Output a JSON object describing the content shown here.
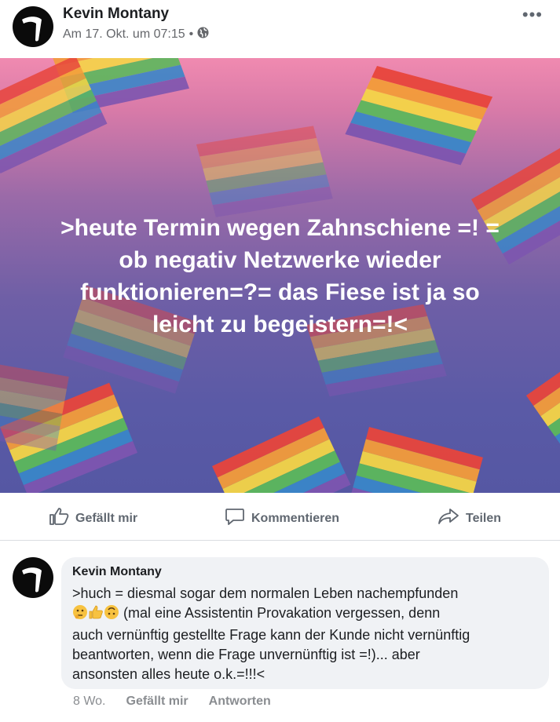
{
  "post": {
    "author": "Kevin Montany",
    "date": "Am 17. Okt. um 07:15",
    "separator": "•",
    "privacy_icon": "globe-icon",
    "more_icon": "more-options-icon",
    "text": ">heute Termin wegen Zahnschiene =! =\nob negativ Netzwerke wieder\nfunktionieren=?= das Fiese ist  ja so\nleicht zu begeistern=!<"
  },
  "actions": {
    "like": "Gefällt mir",
    "comment": "Kommentieren",
    "share": "Teilen"
  },
  "comment": {
    "author": "Kevin Montany",
    "text_line1": ">huch = diesmal sogar dem normalen Leben nachempfunden",
    "emojis": [
      "thinking-face",
      "thumbs-up",
      "upside-down-face"
    ],
    "text_rest": " (mal eine Assistentin Provakation  vergessen, denn\nauch vernünftig gestellte Frage kann der Kunde nicht vernünftig\nbeantworten, wenn die Frage unvernünftig ist =!)... aber\nansonsten alles heute  o.k.=!!!<",
    "time": "8 Wo.",
    "like": "Gefällt mir",
    "reply": "Antworten"
  },
  "colors": {
    "image_top": "#f08ab0",
    "image_bottom": "#5557a3",
    "action_text": "#606770",
    "bubble": "#f0f2f5"
  }
}
